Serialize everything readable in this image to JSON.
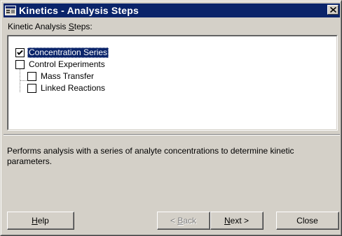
{
  "window": {
    "title": "Kinetics - Analysis Steps",
    "close_glyph": "×"
  },
  "steps_label": {
    "before": "Kinetic Analysis ",
    "mnemonic": "S",
    "after": "teps:"
  },
  "tree": {
    "items": [
      {
        "label": "Concentration Series",
        "checked": true,
        "selected": true,
        "level": 0
      },
      {
        "label": "Control Experiments",
        "checked": false,
        "selected": false,
        "level": 0
      },
      {
        "label": "Mass Transfer",
        "checked": false,
        "selected": false,
        "level": 1
      },
      {
        "label": "Linked Reactions",
        "checked": false,
        "selected": false,
        "level": 1
      }
    ]
  },
  "description": "Performs analysis with a series of analyte concentrations to determine kinetic parameters.",
  "buttons": {
    "help": {
      "mnemonic": "H",
      "rest": "elp"
    },
    "back": {
      "prefix": "< ",
      "mnemonic": "B",
      "rest": "ack",
      "disabled": true
    },
    "next": {
      "mnemonic": "N",
      "rest": "ext >"
    },
    "close": {
      "label": "Close"
    }
  },
  "colors": {
    "titlebar": "#0a246a",
    "face": "#d4d0c8",
    "selection": "#0a246a"
  },
  "icons": {
    "app": "window-app-icon",
    "close": "close-icon",
    "checkmark": "checkmark-icon"
  }
}
